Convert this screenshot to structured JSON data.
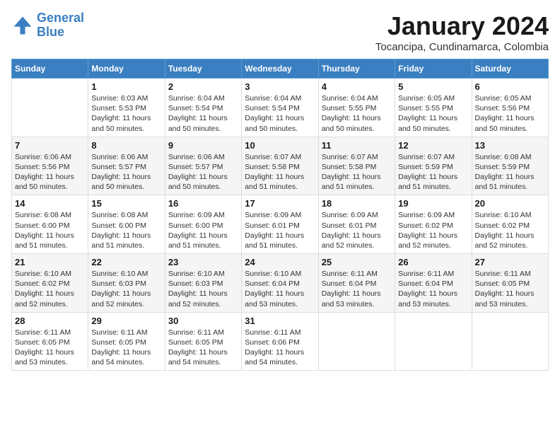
{
  "header": {
    "logo_line1": "General",
    "logo_line2": "Blue",
    "month": "January 2024",
    "location": "Tocancipa, Cundinamarca, Colombia"
  },
  "weekdays": [
    "Sunday",
    "Monday",
    "Tuesday",
    "Wednesday",
    "Thursday",
    "Friday",
    "Saturday"
  ],
  "weeks": [
    [
      {
        "day": "",
        "info": ""
      },
      {
        "day": "1",
        "info": "Sunrise: 6:03 AM\nSunset: 5:53 PM\nDaylight: 11 hours\nand 50 minutes."
      },
      {
        "day": "2",
        "info": "Sunrise: 6:04 AM\nSunset: 5:54 PM\nDaylight: 11 hours\nand 50 minutes."
      },
      {
        "day": "3",
        "info": "Sunrise: 6:04 AM\nSunset: 5:54 PM\nDaylight: 11 hours\nand 50 minutes."
      },
      {
        "day": "4",
        "info": "Sunrise: 6:04 AM\nSunset: 5:55 PM\nDaylight: 11 hours\nand 50 minutes."
      },
      {
        "day": "5",
        "info": "Sunrise: 6:05 AM\nSunset: 5:55 PM\nDaylight: 11 hours\nand 50 minutes."
      },
      {
        "day": "6",
        "info": "Sunrise: 6:05 AM\nSunset: 5:56 PM\nDaylight: 11 hours\nand 50 minutes."
      }
    ],
    [
      {
        "day": "7",
        "info": "Sunrise: 6:06 AM\nSunset: 5:56 PM\nDaylight: 11 hours\nand 50 minutes."
      },
      {
        "day": "8",
        "info": "Sunrise: 6:06 AM\nSunset: 5:57 PM\nDaylight: 11 hours\nand 50 minutes."
      },
      {
        "day": "9",
        "info": "Sunrise: 6:06 AM\nSunset: 5:57 PM\nDaylight: 11 hours\nand 50 minutes."
      },
      {
        "day": "10",
        "info": "Sunrise: 6:07 AM\nSunset: 5:58 PM\nDaylight: 11 hours\nand 51 minutes."
      },
      {
        "day": "11",
        "info": "Sunrise: 6:07 AM\nSunset: 5:58 PM\nDaylight: 11 hours\nand 51 minutes."
      },
      {
        "day": "12",
        "info": "Sunrise: 6:07 AM\nSunset: 5:59 PM\nDaylight: 11 hours\nand 51 minutes."
      },
      {
        "day": "13",
        "info": "Sunrise: 6:08 AM\nSunset: 5:59 PM\nDaylight: 11 hours\nand 51 minutes."
      }
    ],
    [
      {
        "day": "14",
        "info": "Sunrise: 6:08 AM\nSunset: 6:00 PM\nDaylight: 11 hours\nand 51 minutes."
      },
      {
        "day": "15",
        "info": "Sunrise: 6:08 AM\nSunset: 6:00 PM\nDaylight: 11 hours\nand 51 minutes."
      },
      {
        "day": "16",
        "info": "Sunrise: 6:09 AM\nSunset: 6:00 PM\nDaylight: 11 hours\nand 51 minutes."
      },
      {
        "day": "17",
        "info": "Sunrise: 6:09 AM\nSunset: 6:01 PM\nDaylight: 11 hours\nand 51 minutes."
      },
      {
        "day": "18",
        "info": "Sunrise: 6:09 AM\nSunset: 6:01 PM\nDaylight: 11 hours\nand 52 minutes."
      },
      {
        "day": "19",
        "info": "Sunrise: 6:09 AM\nSunset: 6:02 PM\nDaylight: 11 hours\nand 52 minutes."
      },
      {
        "day": "20",
        "info": "Sunrise: 6:10 AM\nSunset: 6:02 PM\nDaylight: 11 hours\nand 52 minutes."
      }
    ],
    [
      {
        "day": "21",
        "info": "Sunrise: 6:10 AM\nSunset: 6:02 PM\nDaylight: 11 hours\nand 52 minutes."
      },
      {
        "day": "22",
        "info": "Sunrise: 6:10 AM\nSunset: 6:03 PM\nDaylight: 11 hours\nand 52 minutes."
      },
      {
        "day": "23",
        "info": "Sunrise: 6:10 AM\nSunset: 6:03 PM\nDaylight: 11 hours\nand 52 minutes."
      },
      {
        "day": "24",
        "info": "Sunrise: 6:10 AM\nSunset: 6:04 PM\nDaylight: 11 hours\nand 53 minutes."
      },
      {
        "day": "25",
        "info": "Sunrise: 6:11 AM\nSunset: 6:04 PM\nDaylight: 11 hours\nand 53 minutes."
      },
      {
        "day": "26",
        "info": "Sunrise: 6:11 AM\nSunset: 6:04 PM\nDaylight: 11 hours\nand 53 minutes."
      },
      {
        "day": "27",
        "info": "Sunrise: 6:11 AM\nSunset: 6:05 PM\nDaylight: 11 hours\nand 53 minutes."
      }
    ],
    [
      {
        "day": "28",
        "info": "Sunrise: 6:11 AM\nSunset: 6:05 PM\nDaylight: 11 hours\nand 53 minutes."
      },
      {
        "day": "29",
        "info": "Sunrise: 6:11 AM\nSunset: 6:05 PM\nDaylight: 11 hours\nand 54 minutes."
      },
      {
        "day": "30",
        "info": "Sunrise: 6:11 AM\nSunset: 6:05 PM\nDaylight: 11 hours\nand 54 minutes."
      },
      {
        "day": "31",
        "info": "Sunrise: 6:11 AM\nSunset: 6:06 PM\nDaylight: 11 hours\nand 54 minutes."
      },
      {
        "day": "",
        "info": ""
      },
      {
        "day": "",
        "info": ""
      },
      {
        "day": "",
        "info": ""
      }
    ]
  ]
}
